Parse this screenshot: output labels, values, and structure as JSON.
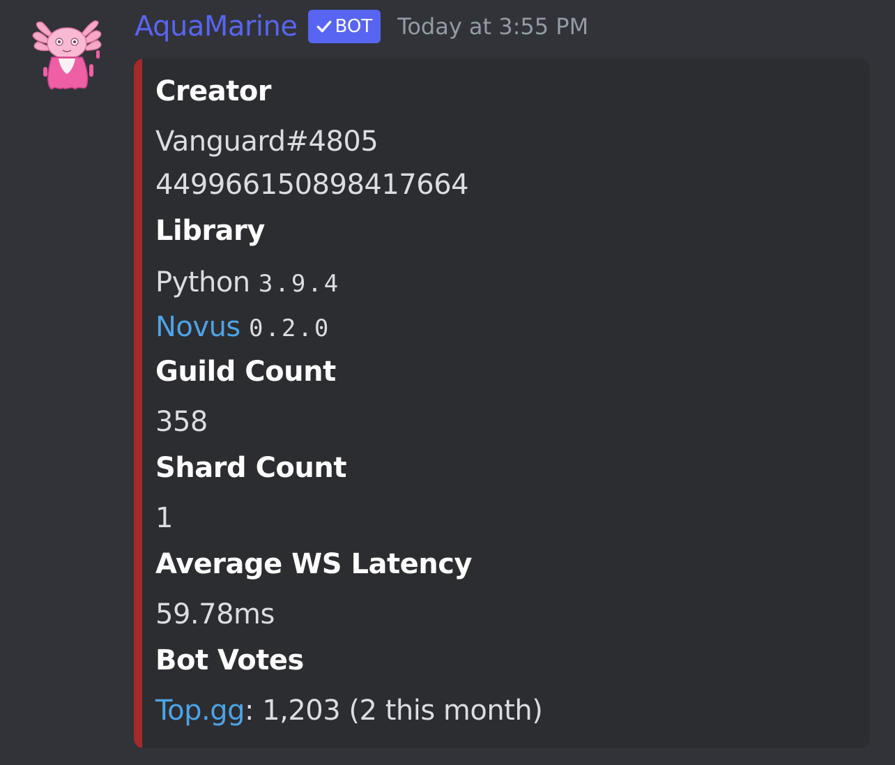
{
  "message": {
    "author": "AquaMarine",
    "bot_tag": "BOT",
    "timestamp": "Today at 3:55 PM",
    "avatar_icon": "pink-axolotl-avatar",
    "username_color": "#5865f2"
  },
  "embed": {
    "accent_color": "#a42a2a",
    "fields": {
      "creator": {
        "name": "Creator",
        "tag": "Vanguard#4805",
        "id": "449966150898417664"
      },
      "library": {
        "name": "Library",
        "python_label": "Python",
        "python_version": "3.9.4",
        "novus_label": "Novus",
        "novus_version": "0.2.0"
      },
      "guild_count": {
        "name": "Guild Count",
        "value": "358"
      },
      "shard_count": {
        "name": "Shard Count",
        "value": "1"
      },
      "latency": {
        "name": "Average WS Latency",
        "value": "59.78ms"
      },
      "votes": {
        "name": "Bot Votes",
        "link_label": "Top.gg",
        "value": ": 1,203 (2 this month)"
      }
    }
  }
}
